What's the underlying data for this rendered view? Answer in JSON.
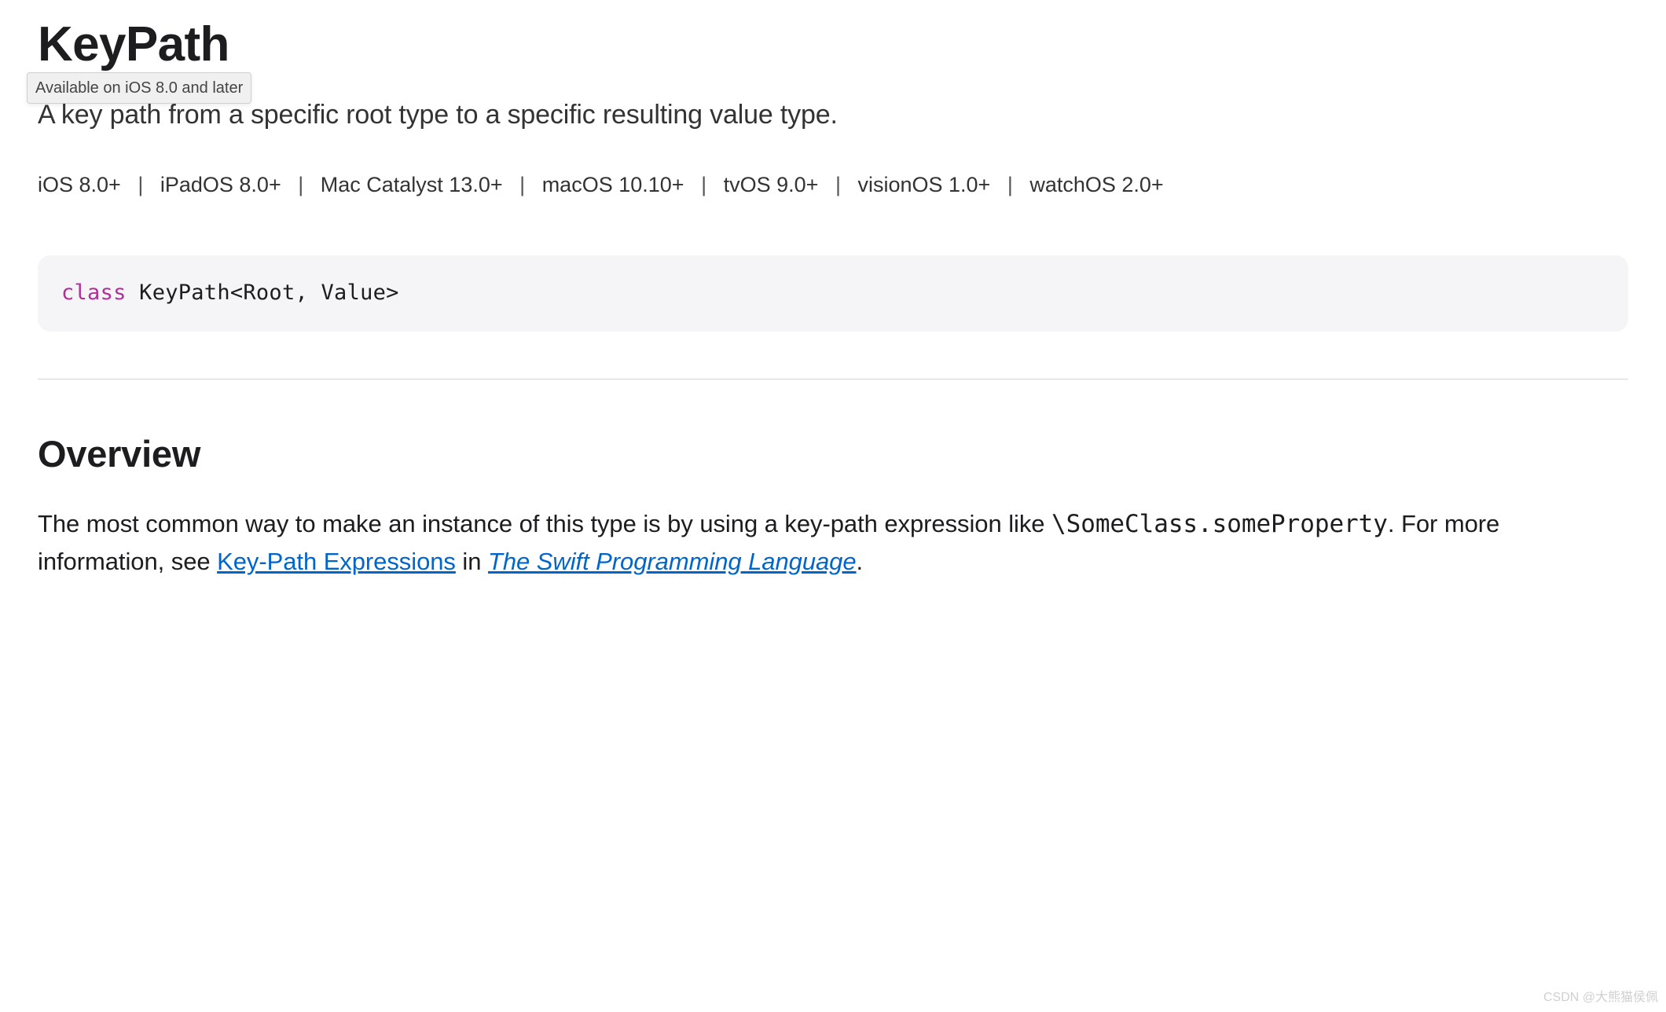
{
  "header": {
    "title": "KeyPath",
    "tooltip": "Available on iOS 8.0 and later",
    "subtitle": "A key path from a specific root type to a specific resulting value type."
  },
  "platforms": {
    "items": [
      "iOS 8.0+",
      "iPadOS 8.0+",
      "Mac Catalyst 13.0+",
      "macOS 10.10+",
      "tvOS 9.0+",
      "visionOS 1.0+",
      "watchOS 2.0+"
    ],
    "separator": "|"
  },
  "declaration": {
    "keyword": "class",
    "rest": " KeyPath<Root, Value>"
  },
  "overview": {
    "heading": "Overview",
    "text_before_code": "The most common way to make an instance of this type is by using a key-path expression like ",
    "inline_code": "\\SomeClass.someProperty",
    "text_after_code": ". For more information, see ",
    "link1_text": "Key-Path Expressions",
    "text_between_links": " in ",
    "link2_text": "The Swift Programming Language",
    "text_end": "."
  },
  "watermark": "CSDN @大熊猫侯佩"
}
